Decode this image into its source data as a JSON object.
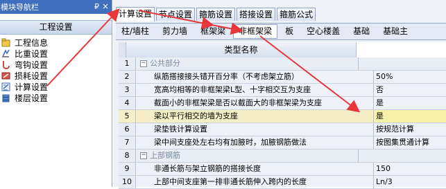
{
  "nav": {
    "title": "模块导航栏",
    "pin_glyph": "₽",
    "close_glyph": "×",
    "section": "工程设置",
    "items": [
      {
        "label": "工程信息",
        "icon": "project-info-icon"
      },
      {
        "label": "比重设置",
        "icon": "density-icon"
      },
      {
        "label": "弯钩设置",
        "icon": "hook-icon"
      },
      {
        "label": "损耗设置",
        "icon": "loss-icon"
      },
      {
        "label": "计算设置",
        "icon": "calc-settings-icon"
      },
      {
        "label": "楼层设置",
        "icon": "floor-icon"
      }
    ]
  },
  "main": {
    "tabs": [
      "计算设置",
      "节点设置",
      "箍筋设置",
      "搭接设置",
      "箍筋公式"
    ],
    "active_tab": "计算设置",
    "subtabs": [
      "柱/墙柱",
      "剪力墙",
      "框架梁",
      "非框架梁",
      "板",
      "空心楼盖",
      "基础",
      "基础主"
    ],
    "active_subtab": "非框架梁",
    "grid": {
      "header": "类型名称",
      "rows": [
        {
          "num": "1",
          "name": "公共部分",
          "value": "",
          "group": true
        },
        {
          "num": "2",
          "name": "纵筋搭接接头错开百分率（不考虑架立筋）",
          "value": "50%"
        },
        {
          "num": "3",
          "name": "宽高均相等的非框架梁L型、十字相交互为支座",
          "value": "否"
        },
        {
          "num": "4",
          "name": "截面小的非框架梁是否以截面大的非框架梁为支座",
          "value": "是"
        },
        {
          "num": "5",
          "name": "梁以平行相交的墙为支座",
          "value": "是",
          "selected": true
        },
        {
          "num": "6",
          "name": "梁垫铁计算设置",
          "value": "按规范计算"
        },
        {
          "num": "7",
          "name": "梁中间支座处左右均有加腋时，加腋钢筋做法",
          "value": "按图集贯通计算"
        },
        {
          "num": "8",
          "name": "上部钢筋",
          "value": "",
          "group": true
        },
        {
          "num": "9",
          "name": "非通长筋与架立钢筋的搭接长度",
          "value": "150"
        },
        {
          "num": "10",
          "name": "上部中间支座第一排非通长筋伸入跨内的长度",
          "value": "Ln/3"
        }
      ]
    }
  },
  "colors": {
    "nav_header": "#3f6fbd",
    "arrow": "#e8373a",
    "selected_row": "#f6eec6",
    "selected_value": "#f6f2a8"
  }
}
